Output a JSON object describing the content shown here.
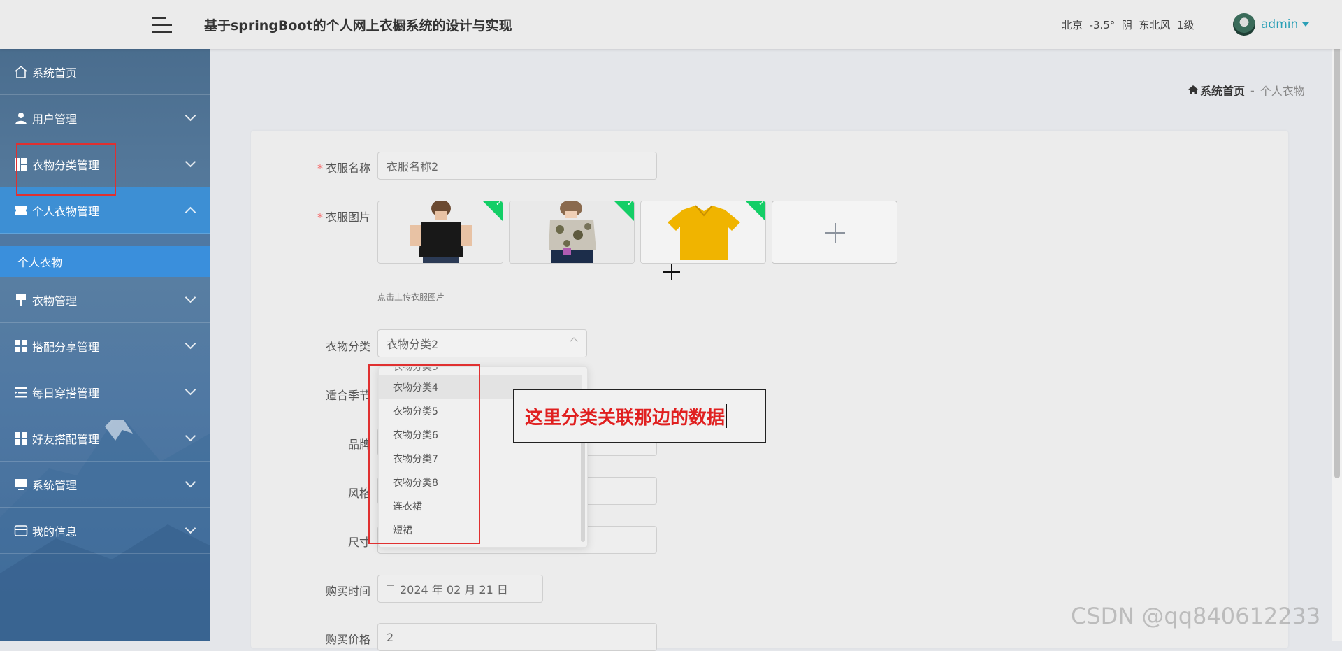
{
  "header": {
    "title": "基于springBoot的个人网上衣橱系统的设计与实现",
    "weather": "北京  -3.5°  阴  东北风  1级",
    "username": "admin"
  },
  "sidebar": {
    "items": [
      {
        "label": "系统首页",
        "icon": "home-icon"
      },
      {
        "label": "用户管理",
        "icon": "user-icon"
      },
      {
        "label": "衣物分类管理",
        "icon": "grid-icon"
      },
      {
        "label": "个人衣物管理",
        "icon": "ticket-icon"
      },
      {
        "label": "衣物管理",
        "icon": "brush-icon"
      },
      {
        "label": "搭配分享管理",
        "icon": "grid-icon"
      },
      {
        "label": "每日穿搭管理",
        "icon": "list-icon"
      },
      {
        "label": "好友搭配管理",
        "icon": "grid-icon"
      },
      {
        "label": "系统管理",
        "icon": "monitor-icon"
      },
      {
        "label": "我的信息",
        "icon": "card-icon"
      }
    ],
    "active_sub": "个人衣物"
  },
  "breadcrumb": {
    "home": "系统首页",
    "separator": "-",
    "current": "个人衣物"
  },
  "form": {
    "name_label": "衣服名称",
    "name_value": "衣服名称2",
    "image_label": "衣服图片",
    "image_hint": "点击上传衣服图片",
    "category_label": "衣物分类",
    "category_value": "衣物分类2",
    "season_label": "适合季节",
    "brand_label": "品牌",
    "style_label": "风格",
    "size_label": "尺寸",
    "date_label": "购买时间",
    "date_value": "2024 年 02 月 21 日",
    "price_label": "购买价格",
    "price_value": "2"
  },
  "dropdown": {
    "options": [
      "衣物分类4",
      "衣物分类5",
      "衣物分类6",
      "衣物分类7",
      "衣物分类8",
      "连衣裙",
      "短裙"
    ],
    "highlighted": "衣物分类4"
  },
  "annotation": "这里分类关联那边的数据",
  "watermark": "CSDN @qq840612233",
  "colors": {
    "accent": "#3a8fdc",
    "required": "#f56c6c",
    "annotation": "#e02020",
    "upload_badge": "#13ce66"
  }
}
